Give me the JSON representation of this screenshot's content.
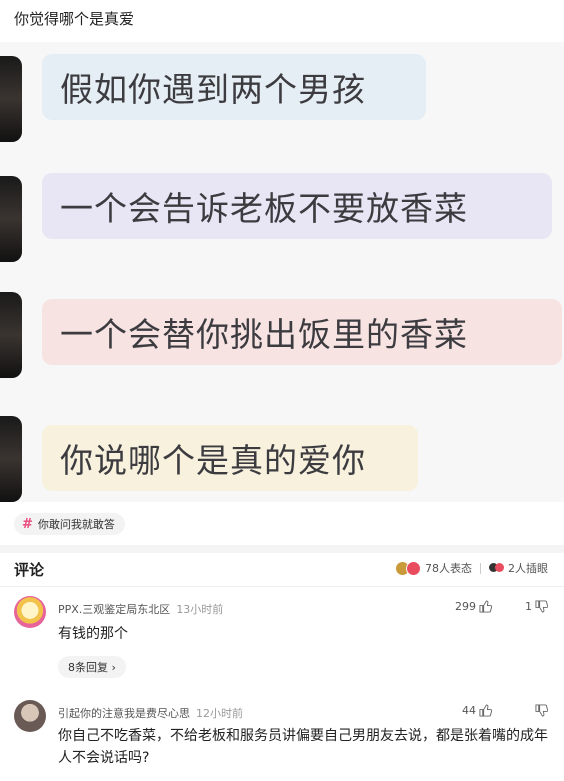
{
  "post": {
    "title": "你觉得哪个是真爱"
  },
  "image": {
    "bubbles": [
      "假如你遇到两个男孩",
      "一个会告诉老板不要放香菜",
      "一个会替你挑出饭里的香菜",
      "你说哪个是真的爱你"
    ]
  },
  "topic": {
    "icon": "hash-icon",
    "label": "你敢问我就敢答"
  },
  "comments_header": {
    "title": "评论",
    "reactions_label": "78人表态",
    "participants_label": "2人插眼",
    "colors": {
      "reaction_a": "#c99a3a",
      "reaction_b": "#e94c5e",
      "hash": "#ea4a7a"
    }
  },
  "comments": [
    {
      "author": "PPX.三观鉴定局东北区",
      "time": "13小时前",
      "likes": "299",
      "dislikes": "1",
      "text": "有钱的那个",
      "replies": "8条回复 ›"
    },
    {
      "author": "引起你的注意我是费尽心思",
      "time": "12小时前",
      "likes": "44",
      "dislikes": "",
      "text": "你自己不吃香菜，不给老板和服务员讲偏要自己男朋友去说，都是张着嘴的成年人不会说话吗?"
    }
  ]
}
